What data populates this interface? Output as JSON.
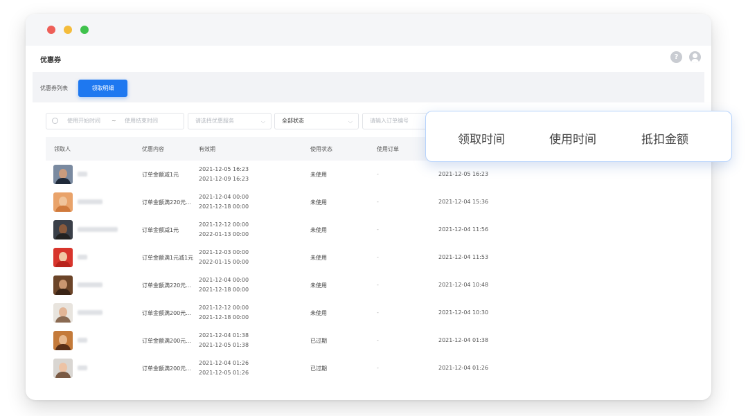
{
  "window": {
    "title": "优惠券",
    "controls": [
      "close-dot",
      "minimize-dot",
      "maximize-dot"
    ],
    "header_icons": [
      "help-icon",
      "user-icon"
    ]
  },
  "toolbar": {
    "breadcrumb": "优惠券列表",
    "active_button": "领取明细"
  },
  "filters": {
    "start_placeholder": "使用开始时间",
    "separator": "~",
    "end_placeholder": "使用结束时间",
    "service_placeholder": "请选择优惠服务",
    "status_value": "全部状态",
    "order_placeholder": "请输入订单编号"
  },
  "table": {
    "headers": [
      "领取人",
      "优惠内容",
      "有效期",
      "使用状态",
      "使用订单"
    ],
    "rows": [
      {
        "content": "订单金额减1元",
        "valid_start": "2021-12-05 16:23",
        "valid_end": "2021-12-09 16:23",
        "status": "未使用",
        "order": "-",
        "received": "2021-12-05 16:23"
      },
      {
        "content": "订单金额满220元...",
        "valid_start": "2021-12-04 00:00",
        "valid_end": "2021-12-18 00:00",
        "status": "未使用",
        "order": "-",
        "received": "2021-12-04 15:36"
      },
      {
        "content": "订单金额减1元",
        "valid_start": "2021-12-12 00:00",
        "valid_end": "2022-01-13 00:00",
        "status": "未使用",
        "order": "-",
        "received": "2021-12-04 11:56"
      },
      {
        "content": "订单金额满1元减1元",
        "valid_start": "2021-12-03 00:00",
        "valid_end": "2022-01-15 00:00",
        "status": "未使用",
        "order": "-",
        "received": "2021-12-04 11:53"
      },
      {
        "content": "订单金额满220元...",
        "valid_start": "2021-12-04 00:00",
        "valid_end": "2021-12-18 00:00",
        "status": "未使用",
        "order": "-",
        "received": "2021-12-04 10:48"
      },
      {
        "content": "订单金额满200元...",
        "valid_start": "2021-12-12 00:00",
        "valid_end": "2021-12-18 00:00",
        "status": "未使用",
        "order": "-",
        "received": "2021-12-04 10:30"
      },
      {
        "content": "订单金额满200元...",
        "valid_start": "2021-12-04 01:38",
        "valid_end": "2021-12-05 01:38",
        "status": "已过期",
        "order": "-",
        "received": "2021-12-04 01:38"
      },
      {
        "content": "订单金额满200元...",
        "valid_start": "2021-12-04 01:26",
        "valid_end": "2021-12-05 01:26",
        "status": "已过期",
        "order": "-",
        "received": "2021-12-04 01:26"
      }
    ]
  },
  "popup_columns": [
    "领取时间",
    "使用时间",
    "抵扣金额"
  ],
  "colors": {
    "accent": "#1e78f0",
    "close": "#ee5f58",
    "minimize": "#f4bc3b",
    "maximize": "#3fc24c"
  }
}
